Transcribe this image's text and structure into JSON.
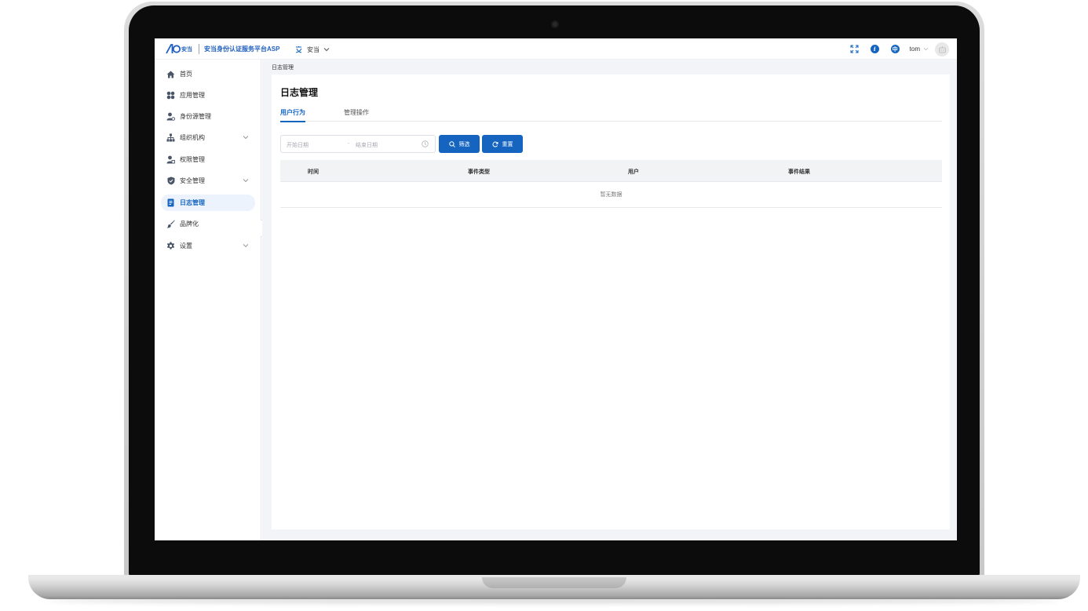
{
  "app": {
    "logo_text": "安当",
    "title": "安当身份认证服务平台ASP",
    "tenant": "安当"
  },
  "header": {
    "lang_badge": "中",
    "info_badge": "i",
    "username": "tom"
  },
  "sidebar": {
    "items": [
      {
        "label": "首页",
        "icon": "home-icon",
        "has_children": false,
        "active": false
      },
      {
        "label": "应用管理",
        "icon": "apps-icon",
        "has_children": false,
        "active": false
      },
      {
        "label": "身份源管理",
        "icon": "identity-source-icon",
        "has_children": false,
        "active": false
      },
      {
        "label": "组织机构",
        "icon": "org-tree-icon",
        "has_children": true,
        "active": false
      },
      {
        "label": "权限管理",
        "icon": "permission-icon",
        "has_children": false,
        "active": false
      },
      {
        "label": "安全管理",
        "icon": "shield-icon",
        "has_children": true,
        "active": false
      },
      {
        "label": "日志管理",
        "icon": "log-icon",
        "has_children": false,
        "active": true
      },
      {
        "label": "品牌化",
        "icon": "brush-icon",
        "has_children": false,
        "active": false
      },
      {
        "label": "设置",
        "icon": "gear-icon",
        "has_children": true,
        "active": false
      }
    ]
  },
  "main": {
    "breadcrumb": "日志管理",
    "page_title": "日志管理",
    "tabs": [
      {
        "label": "用户行为",
        "active": true
      },
      {
        "label": "管理操作",
        "active": false
      }
    ],
    "filters": {
      "start_placeholder": "开始日期",
      "separator": "-",
      "end_placeholder": "结束日期",
      "filter_button": "筛选",
      "reset_button": "重置"
    },
    "table": {
      "columns": [
        "时间",
        "事件类型",
        "用户",
        "事件结果"
      ],
      "rows": [],
      "empty_text": "暂无数据"
    }
  },
  "colors": {
    "primary": "#1565c0",
    "sidebar_active_bg": "#edf3fc",
    "page_bg": "#f2f4f7"
  }
}
